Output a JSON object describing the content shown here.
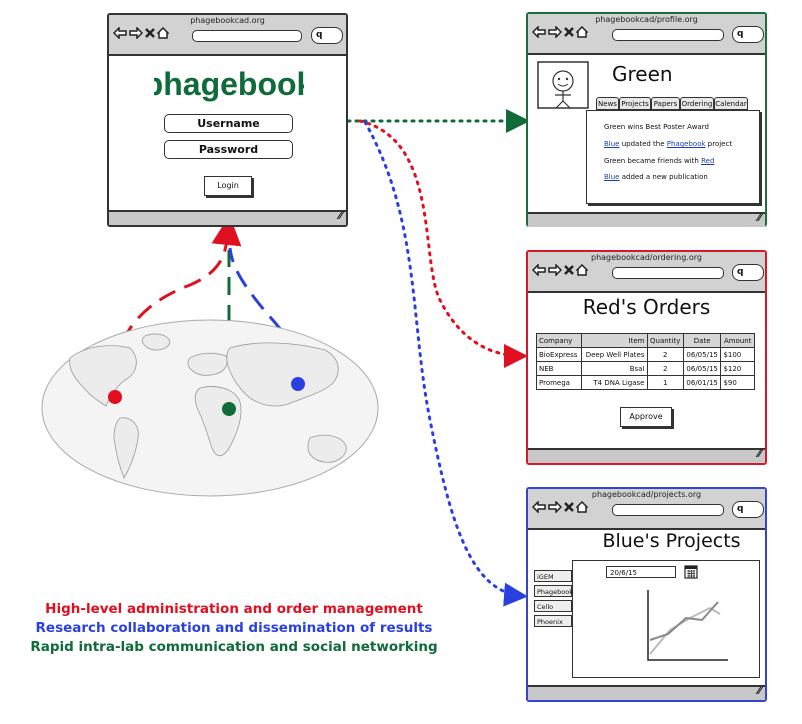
{
  "login_window": {
    "url": "phagebookcad.org",
    "logo": "phagebook",
    "username_label": "Username",
    "password_label": "Password",
    "login_button": "Login"
  },
  "profile_window": {
    "url": "phagebookcad/profile.org",
    "name": "Green",
    "tabs": [
      "News",
      "Projects",
      "Papers",
      "Ordering",
      "Calendar"
    ],
    "feed": [
      {
        "pre": "Green wins Best Poster Award",
        "link": "",
        "mid": "",
        "link2": "",
        "post": ""
      },
      {
        "pre": "",
        "link": "Blue",
        "mid": " updated the ",
        "link2": "Phagebook",
        "post": " project"
      },
      {
        "pre": "Green became friends with ",
        "link": "",
        "mid": "",
        "link2": "Red",
        "post": ""
      },
      {
        "pre": "",
        "link": "Blue",
        "mid": " added a new publication",
        "link2": "",
        "post": ""
      }
    ]
  },
  "orders_window": {
    "url": "phagebookcad/ordering.org",
    "title": "Red's Orders",
    "columns": [
      "Company",
      "Item",
      "Quantity",
      "Date",
      "Amount"
    ],
    "rows": [
      [
        "BioExpress",
        "Deep Well Plates",
        "2",
        "06/05/15",
        "$100"
      ],
      [
        "NEB",
        "BsaI",
        "2",
        "06/05/15",
        "$120"
      ],
      [
        "Promega",
        "T4 DNA Ligase",
        "1",
        "06/01/15",
        "$90"
      ]
    ],
    "approve_button": "Approve"
  },
  "projects_window": {
    "url": "phagebookcad/projects.org",
    "title": "Blue's Projects",
    "projects": [
      "iGEM",
      "Phagebook",
      "Cello",
      "Phoenix"
    ],
    "date": "20/6/15"
  },
  "legend": {
    "red": "High-level administration and order management",
    "blue": "Research collaboration and dissemination of results",
    "green": "Rapid intra-lab communication and social networking"
  },
  "colors": {
    "red": "#e01020",
    "blue": "#2a3fe0",
    "green": "#0f6b3a"
  }
}
